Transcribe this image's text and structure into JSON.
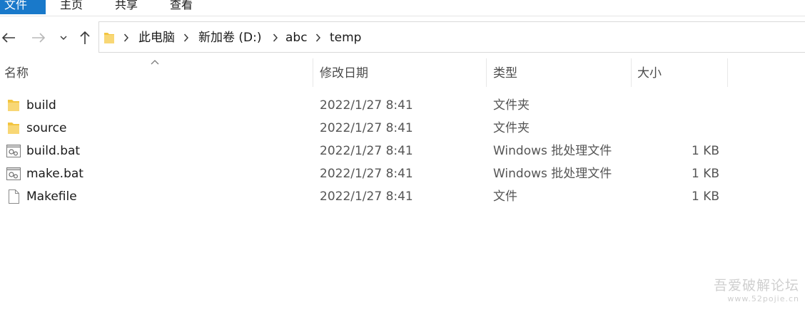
{
  "ribbon": {
    "tabs": [
      "文件",
      "主页",
      "共享",
      "查看"
    ]
  },
  "nav": {
    "breadcrumbs": [
      "此电脑",
      "新加卷 (D:)",
      "abc",
      "temp"
    ]
  },
  "columns": {
    "name": "名称",
    "date": "修改日期",
    "type": "类型",
    "size": "大小"
  },
  "files": [
    {
      "name": "build",
      "date": "2022/1/27 8:41",
      "type": "文件夹",
      "size": "",
      "icon": "folder-icon"
    },
    {
      "name": "source",
      "date": "2022/1/27 8:41",
      "type": "文件夹",
      "size": "",
      "icon": "folder-icon"
    },
    {
      "name": "build.bat",
      "date": "2022/1/27 8:41",
      "type": "Windows 批处理文件",
      "size": "1 KB",
      "icon": "batch-file-icon"
    },
    {
      "name": "make.bat",
      "date": "2022/1/27 8:41",
      "type": "Windows 批处理文件",
      "size": "1 KB",
      "icon": "batch-file-icon"
    },
    {
      "name": "Makefile",
      "date": "2022/1/27 8:41",
      "type": "文件",
      "size": "1 KB",
      "icon": "file-icon"
    }
  ],
  "watermark": {
    "title": "吾爱破解论坛",
    "url": "www.52pojie.cn"
  },
  "colors": {
    "accent": "#1979ca",
    "folder": "#f3c540"
  }
}
